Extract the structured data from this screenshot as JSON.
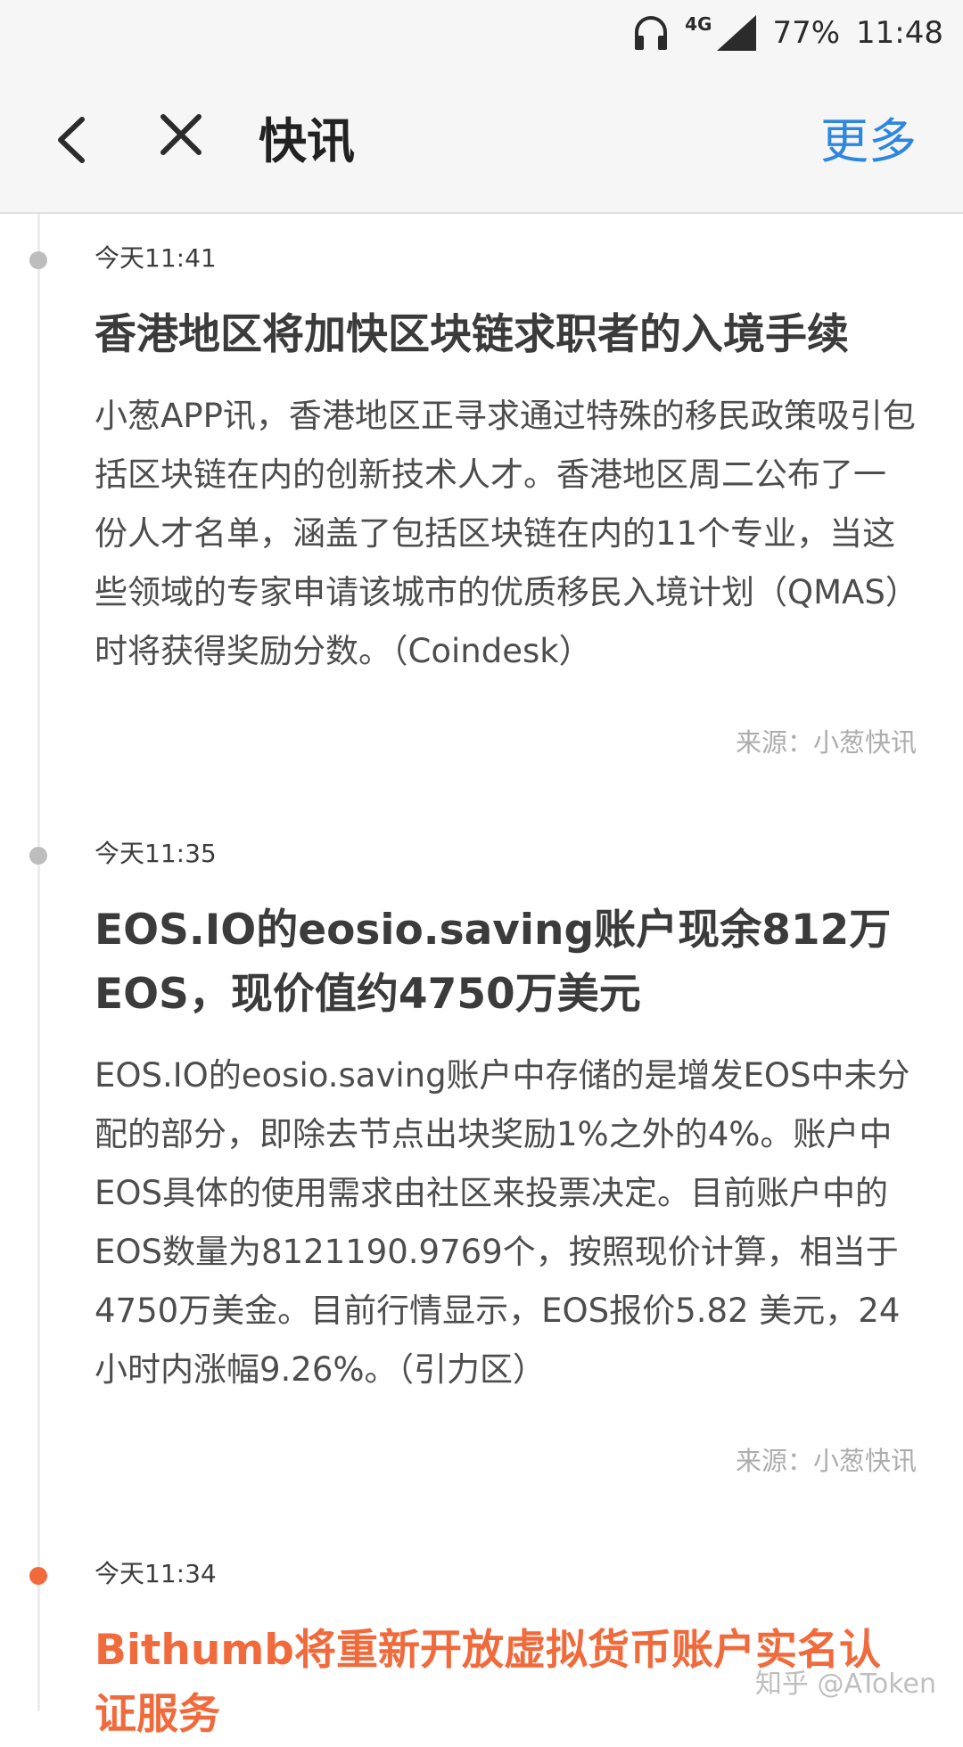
{
  "status_bar": {
    "headset_icon": "headset-icon",
    "network": "4G",
    "battery": "77%",
    "time": "11:48"
  },
  "nav": {
    "back_icon": "chevron-left-icon",
    "close_icon": "close-icon",
    "title": "快讯",
    "more_label": "更多"
  },
  "news": [
    {
      "time": "今天11:41",
      "headline": "香港地区将加快区块链求职者的入境手续",
      "body": "小葱APP讯，香港地区正寻求通过特殊的移民政策吸引包括区块链在内的创新技术人才。香港地区周二公布了一份人才名单，涵盖了包括区块链在内的11个专业，当这些领域的专家申请该城市的优质移民入境计划（QMAS）时将获得奖励分数。（Coindesk）",
      "source": "来源：小葱快讯"
    },
    {
      "time": "今天11:35",
      "headline": "EOS.IO的eosio.saving账户现余812万EOS，现价值约4750万美元",
      "body": "EOS.IO的eosio.saving账户中存储的是增发EOS中未分配的部分，即除去节点出块奖励1%之外的4%。账户中EOS具体的使用需求由社区来投票决定。目前账户中的EOS数量为8121190.9769个，按照现价计算，相当于4750万美金。目前行情显示，EOS报价5.82 美元，24小时内涨幅9.26%。（引力区）",
      "source": "来源：小葱快讯"
    },
    {
      "time": "今天11:34",
      "headline": "Bithumb将重新开放虚拟货币账户实名认证服务"
    }
  ],
  "watermark": "知乎 @AToken",
  "colors": {
    "accent_blue": "#2d86df",
    "highlight_orange": "#f06a3b",
    "dot_gray": "#bdbdbd"
  }
}
